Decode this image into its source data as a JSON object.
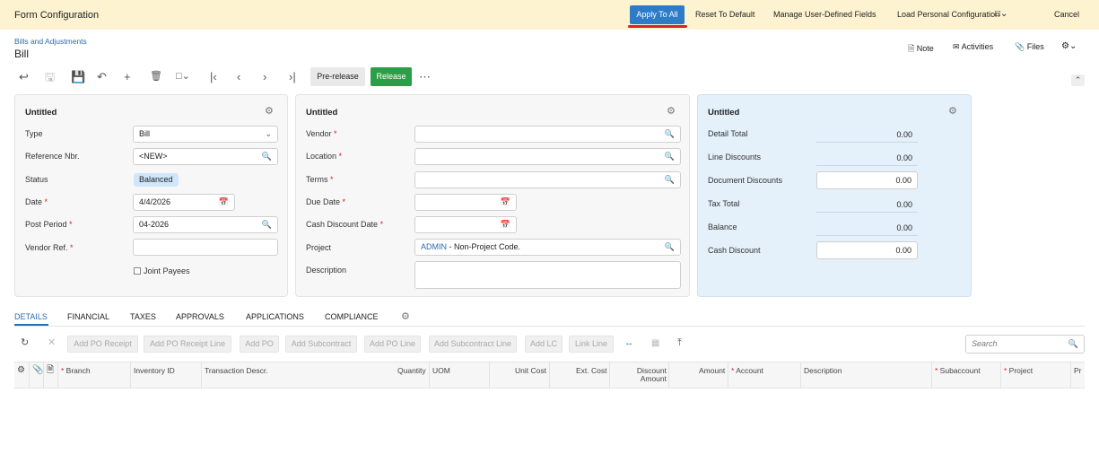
{
  "topbar": {
    "title": "Form Configuration",
    "apply_label": "Apply To All",
    "reset_label": "Reset To Default",
    "manage_label": "Manage User-Defined Fields",
    "load_label": "Load Personal Configuration",
    "cancel_label": "Cancel"
  },
  "header": {
    "breadcrumb": "Bills and Adjustments",
    "title": "Bill",
    "note_label": "Note",
    "activities_label": "Activities",
    "files_label": "Files"
  },
  "toolbar": {
    "prerelease_label": "Pre-release",
    "release_label": "Release"
  },
  "panel1": {
    "title": "Untitled",
    "type_label": "Type",
    "type_value": "Bill",
    "refnbr_label": "Reference Nbr.",
    "refnbr_value": "<NEW>",
    "status_label": "Status",
    "status_value": "Balanced",
    "date_label": "Date",
    "date_value": "4/4/2026",
    "postperiod_label": "Post Period",
    "postperiod_value": "04-2026",
    "vendorref_label": "Vendor Ref.",
    "vendorref_value": "",
    "jointpayees_label": "Joint Payees"
  },
  "panel2": {
    "title": "Untitled",
    "vendor_label": "Vendor",
    "location_label": "Location",
    "terms_label": "Terms",
    "duedate_label": "Due Date",
    "cashdisc_label": "Cash Discount Date",
    "project_label": "Project",
    "project_code": "ADMIN",
    "project_desc": " - Non-Project Code.",
    "description_label": "Description"
  },
  "panel3": {
    "title": "Untitled",
    "detail_total_label": "Detail Total",
    "detail_total": "0.00",
    "line_disc_label": "Line Discounts",
    "line_disc": "0.00",
    "doc_disc_label": "Document Discounts",
    "doc_disc": "0.00",
    "tax_total_label": "Tax Total",
    "tax_total": "0.00",
    "balance_label": "Balance",
    "balance": "0.00",
    "cash_disc_label": "Cash Discount",
    "cash_disc": "0.00"
  },
  "tabs": [
    "DETAILS",
    "FINANCIAL",
    "TAXES",
    "APPROVALS",
    "APPLICATIONS",
    "COMPLIANCE"
  ],
  "grid_toolbar": [
    "Add PO Receipt",
    "Add PO Receipt Line",
    "Add PO",
    "Add Subcontract",
    "Add PO Line",
    "Add Subcontract Line",
    "Add LC",
    "Link Line"
  ],
  "grid_search_placeholder": "Search",
  "columns": {
    "branch": "Branch",
    "inventory": "Inventory ID",
    "trandesc": "Transaction Descr.",
    "quantity": "Quantity",
    "uom": "UOM",
    "unitcost": "Unit Cost",
    "extcost": "Ext. Cost",
    "discamt1": "Discount",
    "discamt2": "Amount",
    "amount": "Amount",
    "account": "Account",
    "description": "Description",
    "subaccount": "Subaccount",
    "project": "Project",
    "pr": "Pr"
  },
  "colors": {
    "topbar_bg": "#fdf3d0",
    "accent": "#2e7cc8",
    "release_green": "#2c9e47",
    "summary_bg": "#e4f0fa",
    "required": "#d6202a"
  }
}
